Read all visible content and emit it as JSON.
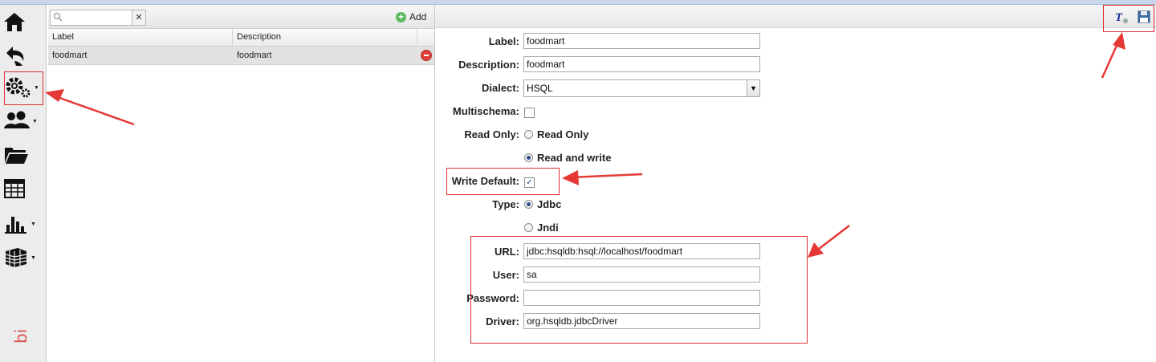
{
  "toolbar": {
    "icons": [
      "home-icon",
      "undo-icon",
      "settings-icon",
      "users-icon",
      "folder-icon",
      "table-icon",
      "bar-chart-icon",
      "cube-icon"
    ],
    "logo_text": "bi"
  },
  "list_panel": {
    "search_placeholder": "",
    "clear_label": "✕",
    "add_label": "Add",
    "columns": [
      "Label",
      "Description"
    ],
    "rows": [
      {
        "label": "foodmart",
        "description": "foodmart"
      }
    ]
  },
  "form": {
    "label_label": "Label:",
    "label_value": "foodmart",
    "description_label": "Description:",
    "description_value": "foodmart",
    "dialect_label": "Dialect:",
    "dialect_value": "HSQL",
    "multischema_label": "Multischema:",
    "multischema_checked": false,
    "readonly_label": "Read Only:",
    "readonly_options": [
      "Read Only",
      "Read and write"
    ],
    "readonly_selected": "Read and write",
    "write_default_label": "Write Default:",
    "write_default_checked": true,
    "type_label": "Type:",
    "type_options": [
      "Jdbc",
      "Jndi"
    ],
    "type_selected": "Jdbc",
    "url_label": "URL:",
    "url_value": "jdbc:hsqldb:hsql://localhost/foodmart",
    "user_label": "User:",
    "user_value": "sa",
    "password_label": "Password:",
    "password_value": "",
    "driver_label": "Driver:",
    "driver_value": "org.hsqldb.jdbcDriver"
  },
  "header_icons": [
    "test-connection-icon",
    "save-icon"
  ],
  "colors": {
    "highlight_box": "#e03030",
    "arrow": "#e53935",
    "accent": "#2b4c8c"
  }
}
